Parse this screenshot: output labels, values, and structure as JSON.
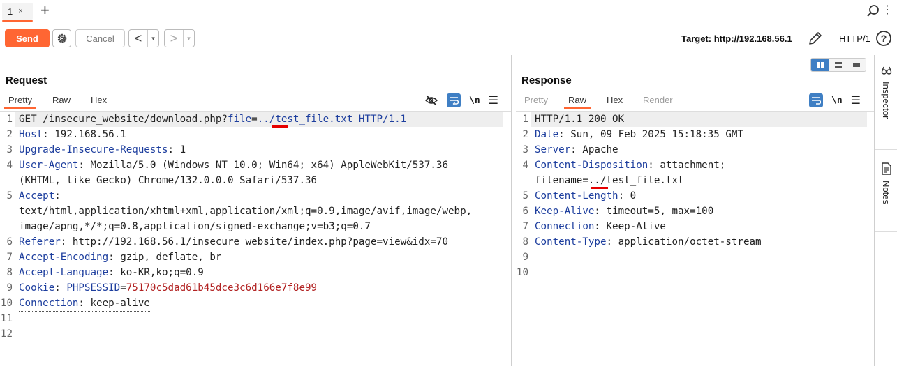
{
  "tabs": [
    {
      "label": "1",
      "close": "×"
    }
  ],
  "newtab_label": "+",
  "toolbar": {
    "send_label": "Send",
    "cancel_label": "Cancel",
    "back_label": "<",
    "forward_label": ">",
    "dropdown_glyph": "▾",
    "target_label": "Target: http://192.168.56.1",
    "http_version": "HTTP/1"
  },
  "request": {
    "title": "Request",
    "tabs": [
      "Pretty",
      "Raw",
      "Hex"
    ],
    "active_tab": "Pretty",
    "newline_label": "\\n",
    "menu_glyph": "☰",
    "line_numbers": [
      "1",
      "2",
      "3",
      "4",
      "",
      "5",
      "",
      "",
      "6",
      "7",
      "8",
      "9",
      "10",
      "11",
      "12"
    ],
    "lines": {
      "l1_method": "GET ",
      "l1_path": "/insecure_website/download.php?",
      "l1_param": "file",
      "l1_eq": "=",
      "l1_traversal": "../",
      "l1_rest": "test_file.txt HTTP/1.1",
      "l2_key": "Host",
      "l2_val": ": 192.168.56.1",
      "l3_key": "Upgrade-Insecure-Requests",
      "l3_val": ": 1",
      "l4_key": "User-Agent",
      "l4_val": ": Mozilla/5.0 (Windows NT 10.0; Win64; x64) AppleWebKit/537.36",
      "l4_cont": "(KHTML, like Gecko) Chrome/132.0.0.0 Safari/537.36",
      "l5_key": "Accept",
      "l5_val": ":",
      "l5_cont1": "text/html,application/xhtml+xml,application/xml;q=0.9,image/avif,image/webp,",
      "l5_cont2": "image/apng,*/*;q=0.8,application/signed-exchange;v=b3;q=0.7",
      "l6_key": "Referer",
      "l6_val": ": http://192.168.56.1/insecure_website/index.php?page=view&idx=70",
      "l7_key": "Accept-Encoding",
      "l7_val": ": gzip, deflate, br",
      "l8_key": "Accept-Language",
      "l8_val": ": ko-KR,ko;q=0.9",
      "l9_key": "Cookie",
      "l9_sep": ": ",
      "l9_name": "PHPSESSID",
      "l9_eq": "=",
      "l9_val": "75170c5dad61b45dce3c6d166e7f8e99",
      "l10_key": "Connection",
      "l10_val": ": keep-alive"
    }
  },
  "response": {
    "title": "Response",
    "tabs": [
      "Pretty",
      "Raw",
      "Hex",
      "Render"
    ],
    "active_tab": "Raw",
    "newline_label": "\\n",
    "menu_glyph": "☰",
    "line_numbers": [
      "1",
      "2",
      "3",
      "4",
      "",
      "5",
      "6",
      "7",
      "8",
      "9",
      "10"
    ],
    "lines": {
      "l1": "HTTP/1.1 200 OK",
      "l2_key": "Date",
      "l2_val": ": Sun, 09 Feb 2025 15:18:35 GMT",
      "l3_key": "Server",
      "l3_val": ": Apache",
      "l4_key": "Content-Disposition",
      "l4_val": ": attachment;",
      "l4_cont_a": "filename=",
      "l4_cont_b": "../",
      "l4_cont_c": "test_file.txt",
      "l5_key": "Content-Length",
      "l5_val": ": 0",
      "l6_key": "Keep-Alive",
      "l6_val": ": timeout=5, max=100",
      "l7_key": "Connection",
      "l7_val": ": Keep-Alive",
      "l8_key": "Content-Type",
      "l8_val": ": application/octet-stream"
    }
  },
  "sidebar": {
    "inspector_label": "Inspector",
    "notes_label": "Notes"
  },
  "colors": {
    "accent": "#ff6633",
    "header_key": "#1d3e9e",
    "cookie_value": "#b22222",
    "highlight_bar": "#e60000",
    "toggle_active": "#3f7fc4"
  }
}
